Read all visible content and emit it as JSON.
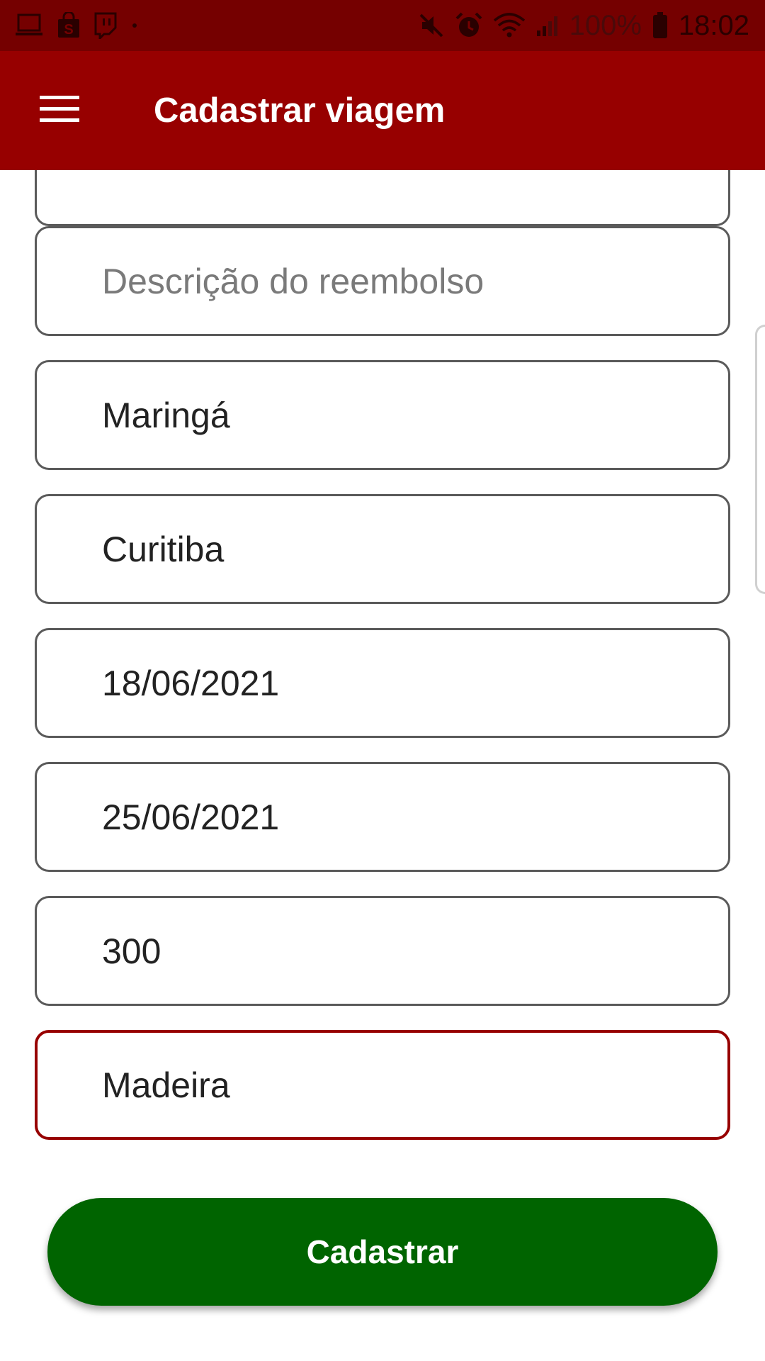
{
  "status_bar": {
    "battery": "100%",
    "time": "18:02",
    "left_icons": [
      "laptop-icon",
      "shopping-bag-icon",
      "twitch-icon",
      "dot-icon"
    ],
    "right_icons": [
      "mute-icon",
      "alarm-icon",
      "wifi-icon",
      "signal-icon",
      "battery-icon"
    ]
  },
  "app_bar": {
    "title": "Cadastrar viagem",
    "menu_icon": "hamburger-menu-icon",
    "color": "#970000"
  },
  "form": {
    "fields": [
      {
        "name": "previous-field",
        "value": "",
        "placeholder": ""
      },
      {
        "name": "reimbursement-description",
        "value": "",
        "placeholder": "Descrição do reembolso"
      },
      {
        "name": "origin",
        "value": "Maringá",
        "placeholder": ""
      },
      {
        "name": "destination",
        "value": "Curitiba",
        "placeholder": ""
      },
      {
        "name": "departure-date",
        "value": "18/06/2021",
        "placeholder": ""
      },
      {
        "name": "return-date",
        "value": "25/06/2021",
        "placeholder": ""
      },
      {
        "name": "amount",
        "value": "300",
        "placeholder": ""
      },
      {
        "name": "vehicle",
        "value": "Madeira",
        "placeholder": ""
      }
    ],
    "focused_field": "vehicle",
    "focus_color": "#970000"
  },
  "submit": {
    "label": "Cadastrar",
    "color": "#006400"
  }
}
